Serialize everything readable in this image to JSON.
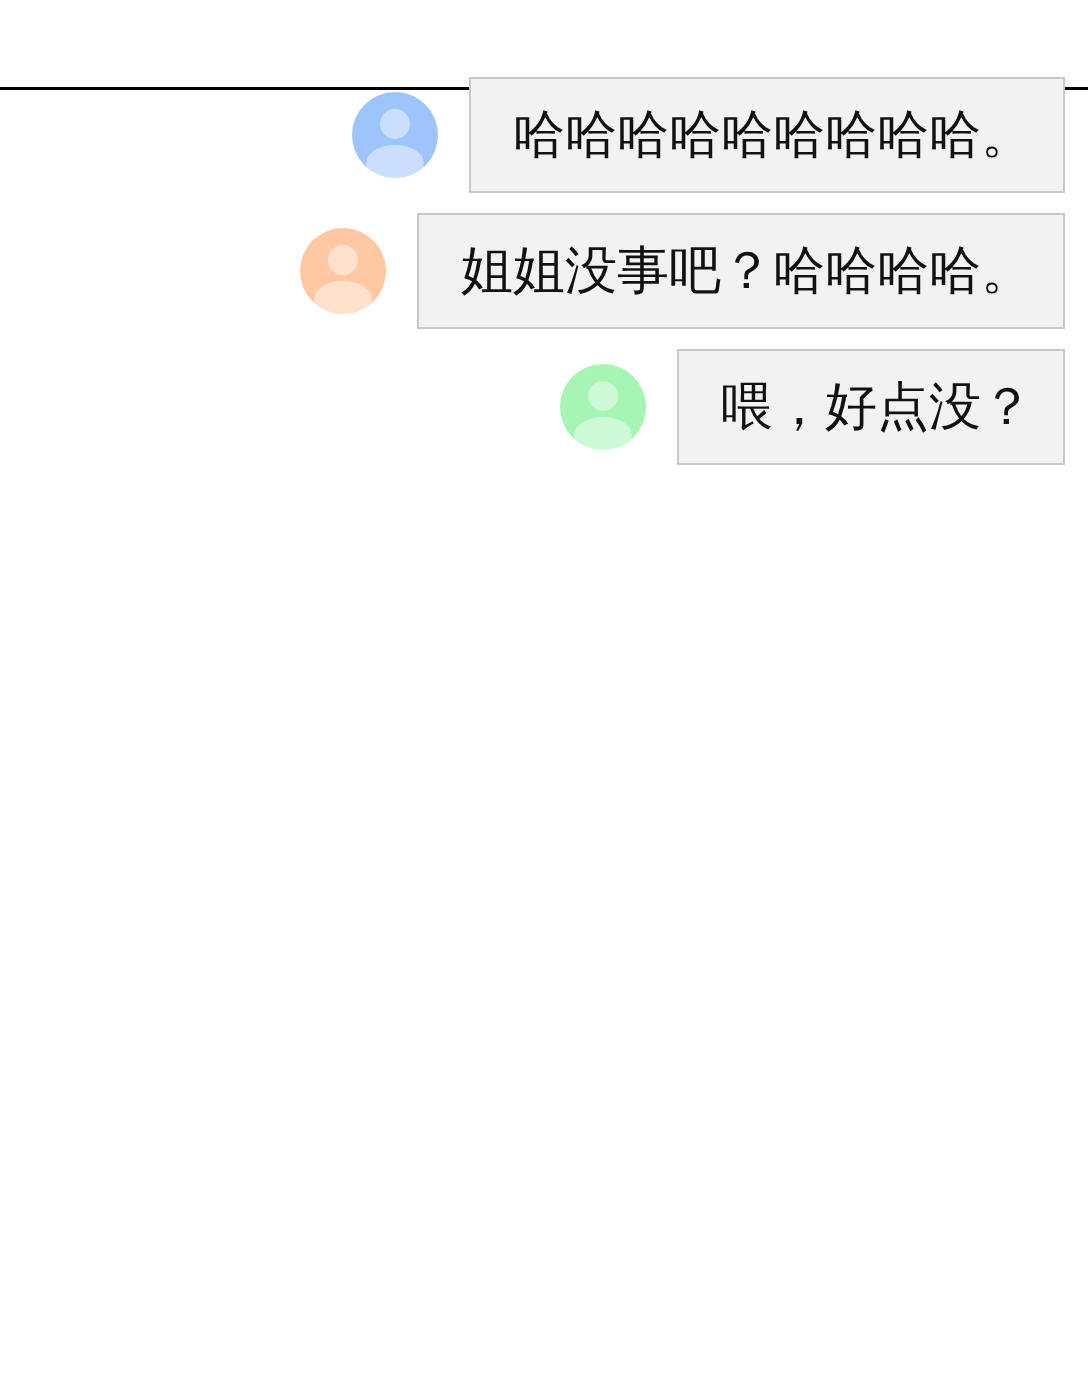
{
  "messages": [
    {
      "text": "哈哈哈哈哈哈哈哈哈。",
      "color": "#9ec5fb"
    },
    {
      "text": "姐姐没事吧？哈哈哈哈。",
      "color": "#fdc8a3"
    },
    {
      "text": "喂，好点没？",
      "color": "#a6f5b5"
    }
  ]
}
